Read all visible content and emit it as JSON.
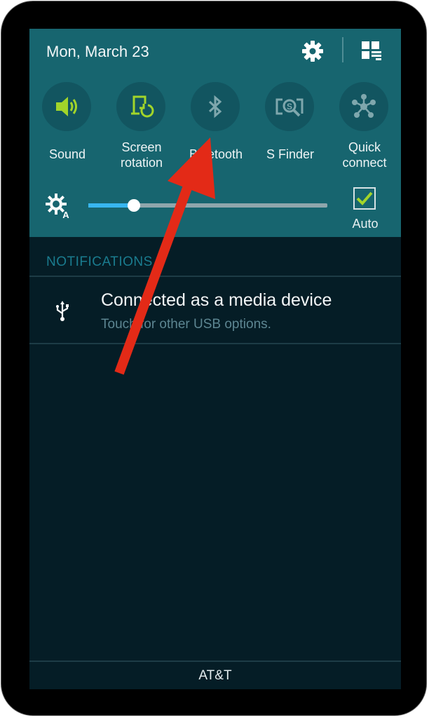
{
  "header": {
    "date": "Mon, March 23",
    "settings_icon": "gear-icon",
    "edit_icon": "grid-edit-icon"
  },
  "toggles": [
    {
      "label": "Sound",
      "icon": "speaker-icon",
      "active": true
    },
    {
      "label": "Screen rotation",
      "line1": "Screen",
      "line2": "rotation",
      "icon": "rotation-icon",
      "active": true
    },
    {
      "label": "Bluetooth",
      "icon": "bluetooth-icon",
      "active": false
    },
    {
      "label": "S Finder",
      "icon": "s-finder-icon",
      "active": false
    },
    {
      "label": "Quick connect",
      "line1": "Quick",
      "line2": "connect",
      "icon": "quick-connect-icon",
      "active": false
    }
  ],
  "brightness": {
    "level": 0.19,
    "auto_label": "Auto",
    "auto_checked": true
  },
  "notifications": {
    "heading": "NOTIFICATIONS",
    "items": [
      {
        "title": "Connected as a media device",
        "subtitle": "Touch for other USB options.",
        "icon": "usb-icon"
      }
    ]
  },
  "carrier": "AT&T",
  "colors": {
    "panel": "#17656f",
    "background": "#051d26",
    "accent_green": "#a2d52a",
    "slider_fill": "#38b6f0",
    "annotation_arrow": "#e32a17"
  }
}
